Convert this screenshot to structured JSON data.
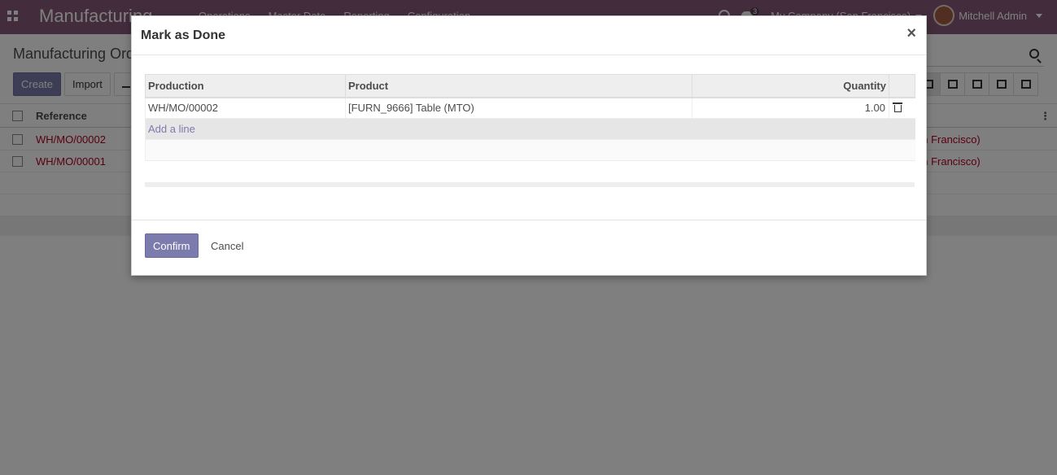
{
  "navbar": {
    "app_name": "Manufacturing",
    "menu": [
      "Operations",
      "Master Data",
      "Reporting",
      "Configuration"
    ],
    "message_count": "3",
    "company": "My Company (San Francisco)",
    "user": "Mitchell Admin"
  },
  "control_panel": {
    "breadcrumb": "Manufacturing Orders",
    "create_label": "Create",
    "import_label": "Import"
  },
  "list": {
    "header_reference": "Reference",
    "rows": [
      {
        "reference": "WH/MO/00002",
        "company": "an Francisco)"
      },
      {
        "reference": "WH/MO/00001",
        "company": "an Francisco)"
      }
    ]
  },
  "modal": {
    "title": "Mark as Done",
    "close_symbol": "×",
    "columns": {
      "production": "Production",
      "product": "Product",
      "quantity": "Quantity"
    },
    "lines": [
      {
        "production": "WH/MO/00002",
        "product": "[FURN_9666] Table (MTO)",
        "quantity": "1.00"
      }
    ],
    "add_line_label": "Add a line",
    "confirm_label": "Confirm",
    "cancel_label": "Cancel"
  }
}
